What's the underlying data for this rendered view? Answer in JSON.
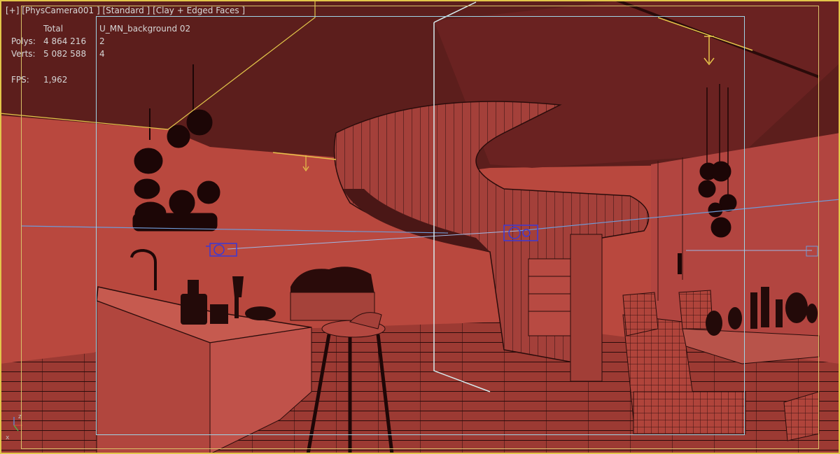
{
  "viewport": {
    "labels": {
      "plus": "[+]",
      "camera": "[PhysCamera001 ]",
      "shading": "[Standard ]",
      "style": "[Clay + Edged Faces ]"
    },
    "stats": {
      "header_total": "Total",
      "header_object": "U_MN_background 02",
      "polys_label": "Polys:",
      "polys_total": "4 864 216",
      "polys_object": "2",
      "verts_label": "Verts:",
      "verts_total": "5 082 588",
      "verts_object": "4",
      "fps_label": "FPS:",
      "fps_value": "1,962"
    },
    "colors": {
      "active_border": "#e2c64a",
      "safe_frame": "#9fd4e6",
      "scene_wall": "#b9483e",
      "scene_ceiling": "#5c1e1c",
      "camera_gizmo": "#3b39d6",
      "light_gizmo": "#e6c24a"
    },
    "axis": {
      "x": "x",
      "y": "y",
      "z": "z"
    }
  }
}
